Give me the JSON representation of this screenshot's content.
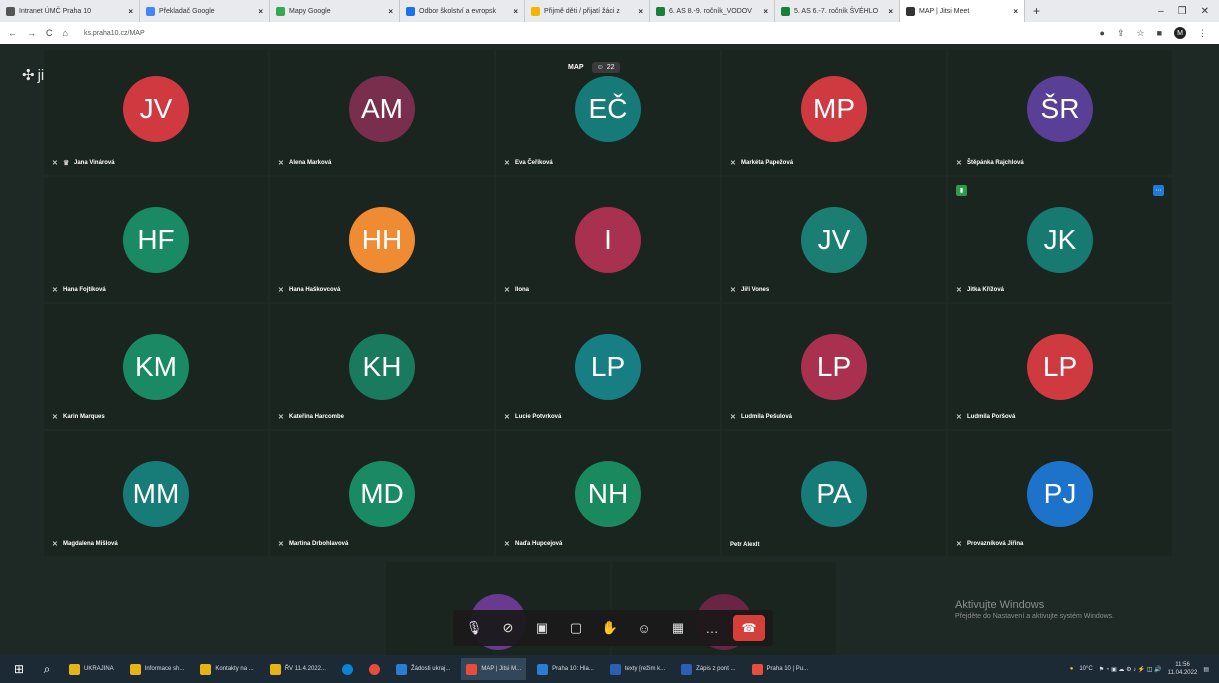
{
  "browser": {
    "tabs": [
      {
        "title": "Intranet ÚMČ Praha 10",
        "color": "#555555"
      },
      {
        "title": "Překladač Google",
        "color": "#4285f4"
      },
      {
        "title": "Mapy Google",
        "color": "#34a853"
      },
      {
        "title": "Odbor školství a evropsk",
        "color": "#1a73e8"
      },
      {
        "title": "Přijmě děti / přijatí žáci z",
        "color": "#f4b400"
      },
      {
        "title": "6. AS 8.-9. ročník_VODOV",
        "color": "#188038"
      },
      {
        "title": "5. AS 6.-7. ročník ŠVÉHLO",
        "color": "#188038"
      },
      {
        "title": "MAP | Jitsi Meet",
        "color": "#333333"
      }
    ],
    "url": "ks.praha10.cz/MAP",
    "profile_initial": "M"
  },
  "meeting": {
    "logo": "jitsi",
    "room_name": "MAP",
    "participant_count": "22",
    "participants": [
      {
        "initials": "JV",
        "name": "Jana Vinárová",
        "color": "#d0393f",
        "moderator": true
      },
      {
        "initials": "AM",
        "name": "Alena Marková",
        "color": "#7a2e4e"
      },
      {
        "initials": "EČ",
        "name": "Eva Čeřiková",
        "color": "#167a78"
      },
      {
        "initials": "MP",
        "name": "Markéta Papežová",
        "color": "#cf3a41"
      },
      {
        "initials": "ŠR",
        "name": "Štěpánka Rajchlová",
        "color": "#5a3f96"
      },
      {
        "initials": "HF",
        "name": "Hana Fojtíková",
        "color": "#1a8a65"
      },
      {
        "initials": "HH",
        "name": "Hana Haškovcová",
        "color": "#ef8c33"
      },
      {
        "initials": "I",
        "name": "Ilona",
        "color": "#a8314f"
      },
      {
        "initials": "JV",
        "name": "Jiří Vones",
        "color": "#1a7f72"
      },
      {
        "initials": "JK",
        "name": "Jitka Křížová",
        "color": "#167a70",
        "badges": true
      },
      {
        "initials": "KM",
        "name": "Karin Marques",
        "color": "#1a8a65"
      },
      {
        "initials": "KH",
        "name": "Kateřina Harcombe",
        "color": "#197a5e"
      },
      {
        "initials": "LP",
        "name": "Lucie Potvrková",
        "color": "#177f83"
      },
      {
        "initials": "LP",
        "name": "Ludmila Pešulová",
        "color": "#a9314f"
      },
      {
        "initials": "LP",
        "name": "Ludmila Poršová",
        "color": "#cf3a41"
      },
      {
        "initials": "MM",
        "name": "Magdalena Mišlová",
        "color": "#177b78"
      },
      {
        "initials": "MD",
        "name": "Martina Drbohlavová",
        "color": "#1a8a65"
      },
      {
        "initials": "NH",
        "name": "Naďa Hupcejová",
        "color": "#1a8a5e"
      },
      {
        "initials": "PA",
        "name": "Petr Alexlt",
        "color": "#177b78",
        "no_mic": true
      },
      {
        "initials": "PJ",
        "name": "Provazníková Jiřina",
        "color": "#1c73c9"
      }
    ],
    "hidden_avatar_colors": [
      "#6a3a8f",
      "#6a2444"
    ],
    "toolbar": [
      "mic-muted-icon",
      "camera-off-icon",
      "screenshare-icon",
      "chat-icon",
      "raise-hand-icon",
      "participants-icon",
      "tile-view-icon",
      "more-icon",
      "hangup-icon"
    ],
    "watermark": {
      "title": "Aktivujte Windows",
      "subtitle": "Přejděte do Nastavení a aktivujte systém Windows."
    }
  },
  "taskbar": {
    "items": [
      {
        "label": "UKRAJINA",
        "color": "#e7b416"
      },
      {
        "label": "Informace sh...",
        "color": "#e7b416"
      },
      {
        "label": "Kontakty na ...",
        "color": "#e7b416"
      },
      {
        "label": "ŘV 11.4.2022...",
        "color": "#e7b416"
      },
      {
        "label": "",
        "color": "#0a84d6"
      },
      {
        "label": "",
        "color": "#e84d3c"
      },
      {
        "label": "Žádosti ukraj...",
        "color": "#2b7cd3"
      },
      {
        "label": "MAP | Jitsi M...",
        "color": "#e84d3c",
        "active": true
      },
      {
        "label": "Praha 10: Hla...",
        "color": "#2b7cd3"
      },
      {
        "label": "texty [režim k...",
        "color": "#2b5fb3"
      },
      {
        "label": "Zápis z pont ...",
        "color": "#2b5fb3"
      },
      {
        "label": "Praha 10 | Pu...",
        "color": "#e84d3c"
      }
    ],
    "weather": "10°C",
    "time": "11:56",
    "date": "11.04.2022"
  }
}
